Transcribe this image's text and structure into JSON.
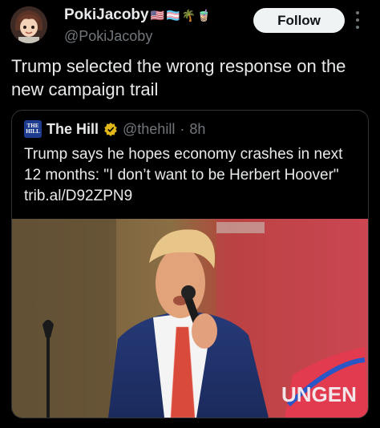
{
  "author": {
    "display_name": "PokiJacoby",
    "handle": "@PokiJacoby",
    "name_emojis": [
      "🇺🇸",
      "🏳️‍⚧️",
      "🌴",
      "🧋"
    ]
  },
  "follow_label": "Follow",
  "tweet_text": "Trump selected the wrong response on the new campaign trail",
  "quote": {
    "logo_text": "THE HILL",
    "name": "The Hill",
    "handle": "@thehill",
    "separator": "·",
    "time": "8h",
    "text": "Trump says he hopes economy crashes in next 12 months: \"I don’t want to be Herbert Hoover\" trib.al/D92ZPN9",
    "image_sign_text": "UNGEN"
  },
  "colors": {
    "background": "#000000",
    "text": "#e7e9ea",
    "muted": "#71767b",
    "border": "#2f3336",
    "verified_gold": "#e2b719",
    "follow_bg": "#eff3f4"
  }
}
